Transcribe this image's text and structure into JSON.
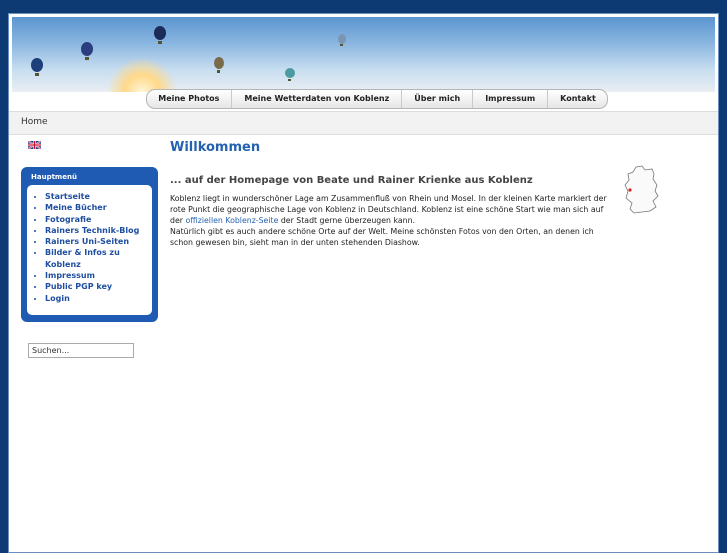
{
  "nav": {
    "items": [
      "Meine Photos",
      "Meine Wetterdaten von Koblenz",
      "Über mich",
      "Impressum",
      "Kontakt"
    ]
  },
  "breadcrumb": "Home",
  "sidebar": {
    "title": "Hauptmenü",
    "items": [
      "Startseite",
      "Meine Bücher",
      "Fotografie",
      "Rainers Technik-Blog",
      "Rainers Uni-Seiten",
      "Bilder & Infos zu Koblenz",
      "Impressum",
      "Public PGP key",
      "Login"
    ]
  },
  "search": {
    "value": "Suchen..."
  },
  "main": {
    "title": "Willkommen",
    "subtitle": "... auf der Homepage von Beate und Rainer Krienke aus Koblenz",
    "paragraph1_part1": "Koblenz liegt in wunderschöner Lage am Zusammenfluß von Rhein und Mosel. In der kleinen Karte markiert der rote Punkt die geographische Lage von Koblenz in Deutschland. Koblenz ist eine schöne Start wie man sich auf  der ",
    "link": "offiziellen Koblenz-Seite",
    "paragraph1_part2": " der Stadt gerne überzeugen kann.",
    "paragraph2": "Natürlich gibt es auch andere schöne Orte auf der Welt. Meine schönsten Fotos von den Orten, an denen ich schon gewesen bin, sieht man in der unten stehenden Diashow."
  },
  "colors": {
    "background": "#0d3a73",
    "accent": "#2462b0",
    "menu": "#1f5bb3"
  }
}
